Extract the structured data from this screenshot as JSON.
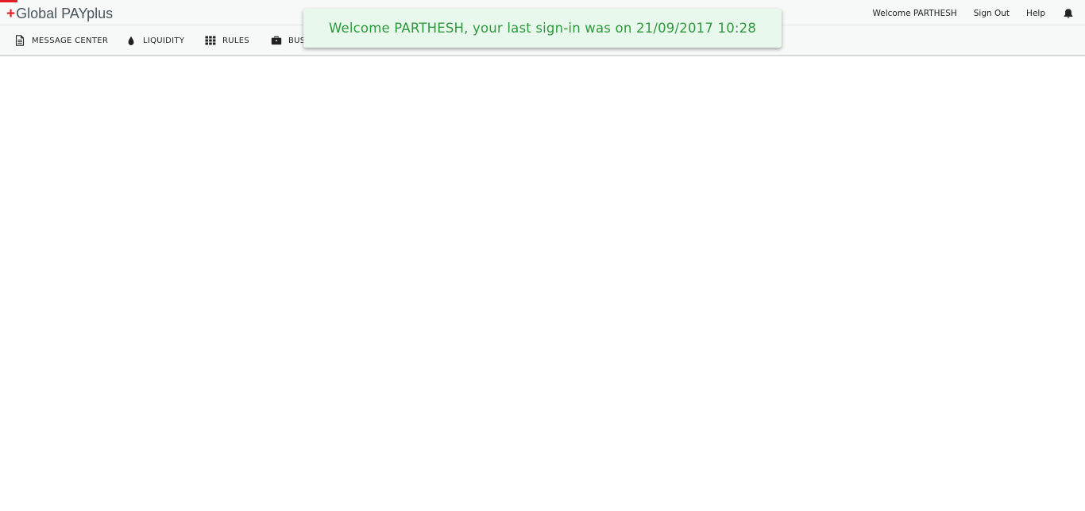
{
  "header": {
    "logo": {
      "plus": "+",
      "text": "Global PAYplus"
    },
    "welcome_text": "Welcome PARTHESH",
    "sign_out_label": "Sign Out",
    "help_label": "Help",
    "notification_icon": "bell-icon"
  },
  "nav": {
    "items": [
      {
        "label": "MESSAGE CENTER",
        "icon": "document-icon"
      },
      {
        "label": "LIQUIDITY",
        "icon": "drop-icon"
      },
      {
        "label": "RULES",
        "icon": "grid-icon"
      },
      {
        "label": "BUS",
        "icon": "briefcase-icon"
      }
    ]
  },
  "toast": {
    "message": "Welcome PARTHESH, your last sign-in was on 21/09/2017 10:28"
  },
  "colors": {
    "brand_red": "#e31b23",
    "toast_text": "#2e9a3e",
    "toast_bg": "#e8f8ec"
  }
}
